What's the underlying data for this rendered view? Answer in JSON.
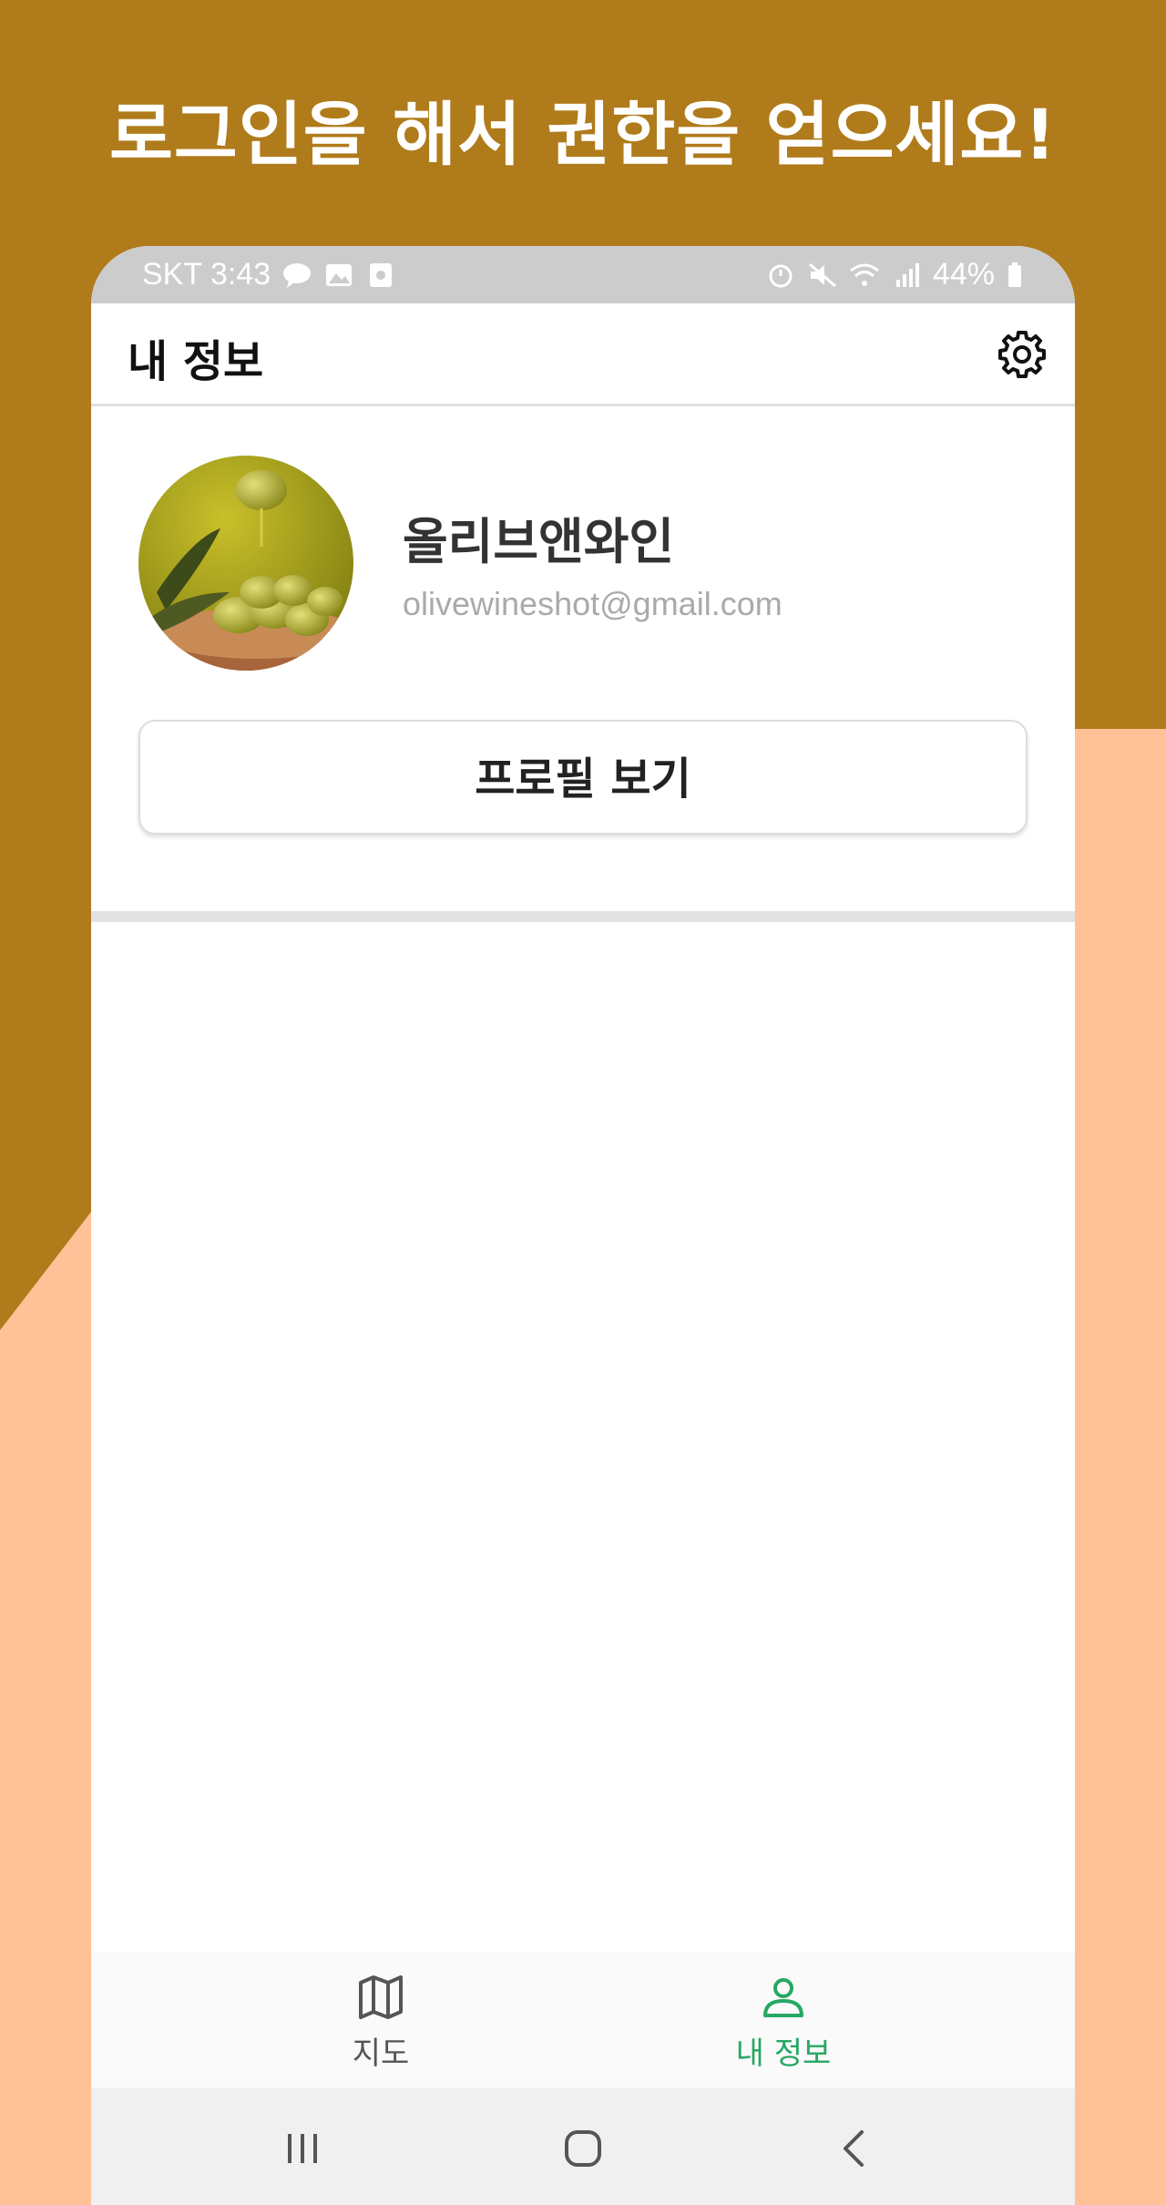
{
  "headline": "로그인을 해서 권한을 얻으세요!",
  "colors": {
    "background": "#b07b1b",
    "accent_shape": "#ffc198",
    "active_nav": "#26a862"
  },
  "status_bar": {
    "left_text": "SKT 3:43",
    "battery": "44%",
    "icons": [
      "talk-bubble-icon",
      "gallery-icon",
      "square-icon",
      "alarm-icon",
      "mute-icon",
      "wifi-icon",
      "signal-icon",
      "battery-icon"
    ]
  },
  "app_bar": {
    "title": "내 정보",
    "settings_icon": "gear-icon"
  },
  "profile": {
    "name": "올리브앤와인",
    "email": "olivewineshot@gmail.com",
    "avatar": "olive-photo",
    "view_profile_label": "프로필 보기"
  },
  "bottom_nav": {
    "items": [
      {
        "label": "지도",
        "icon": "map-icon",
        "active": false
      },
      {
        "label": "내 정보",
        "icon": "person-icon",
        "active": true
      }
    ]
  },
  "system_nav": [
    "recents-icon",
    "home-icon",
    "back-icon"
  ]
}
